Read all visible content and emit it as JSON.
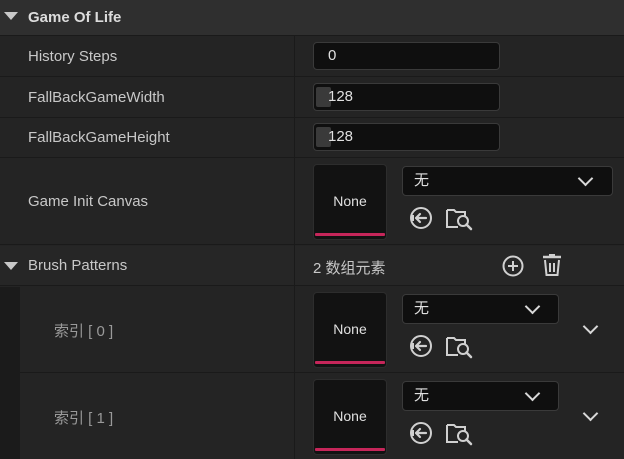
{
  "category": {
    "title": "Game Of Life"
  },
  "properties": {
    "history_steps": {
      "label": "History Steps",
      "value": "0"
    },
    "fallback_width": {
      "label": "FallBackGameWidth",
      "value": "128"
    },
    "fallback_height": {
      "label": "FallBackGameHeight",
      "value": "128"
    },
    "game_init_canvas": {
      "label": "Game Init Canvas",
      "thumbnail": "None",
      "asset": "无"
    }
  },
  "brush_patterns": {
    "label": "Brush Patterns",
    "count_text": "2 数组元素",
    "elements": [
      {
        "label": "索引 [ 0 ]",
        "thumbnail": "None",
        "asset": "无"
      },
      {
        "label": "索引 [ 1 ]",
        "thumbnail": "None",
        "asset": "无"
      }
    ]
  },
  "icons": {
    "expand": "triangle-down-icon",
    "use_selected": "arrow-left-circle-icon",
    "browse": "folder-search-icon",
    "add": "plus-circle-icon",
    "delete": "trash-icon",
    "dropdown": "chevron-down-icon"
  },
  "colors": {
    "background": "#242424",
    "header": "#2f2f2f",
    "input": "#0f0f0f",
    "thumbnail_accent": "#c6265a"
  }
}
